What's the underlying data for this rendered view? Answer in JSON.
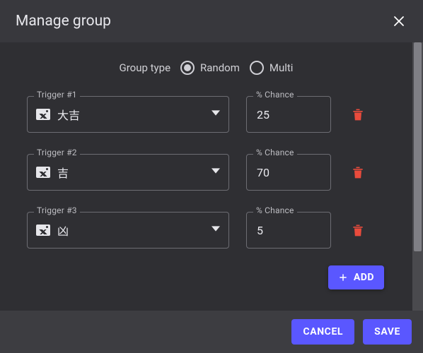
{
  "header": {
    "title": "Manage group"
  },
  "groupType": {
    "label": "Group type",
    "options": {
      "random": "Random",
      "multi": "Multi"
    },
    "selected": "random"
  },
  "rows": [
    {
      "triggerLabel": "Trigger #1",
      "triggerName": "大吉",
      "chanceLabel": "% Chance",
      "chanceValue": "25"
    },
    {
      "triggerLabel": "Trigger #2",
      "triggerName": "吉",
      "chanceLabel": "% Chance",
      "chanceValue": "70"
    },
    {
      "triggerLabel": "Trigger #3",
      "triggerName": "凶",
      "chanceLabel": "% Chance",
      "chanceValue": "5"
    }
  ],
  "buttons": {
    "add": "ADD",
    "cancel": "CANCEL",
    "save": "SAVE"
  },
  "icons": {
    "close": "close-icon",
    "image": "image-icon",
    "dropdown": "chevron-down-icon",
    "trash": "trash-icon",
    "plus": "plus-icon"
  }
}
